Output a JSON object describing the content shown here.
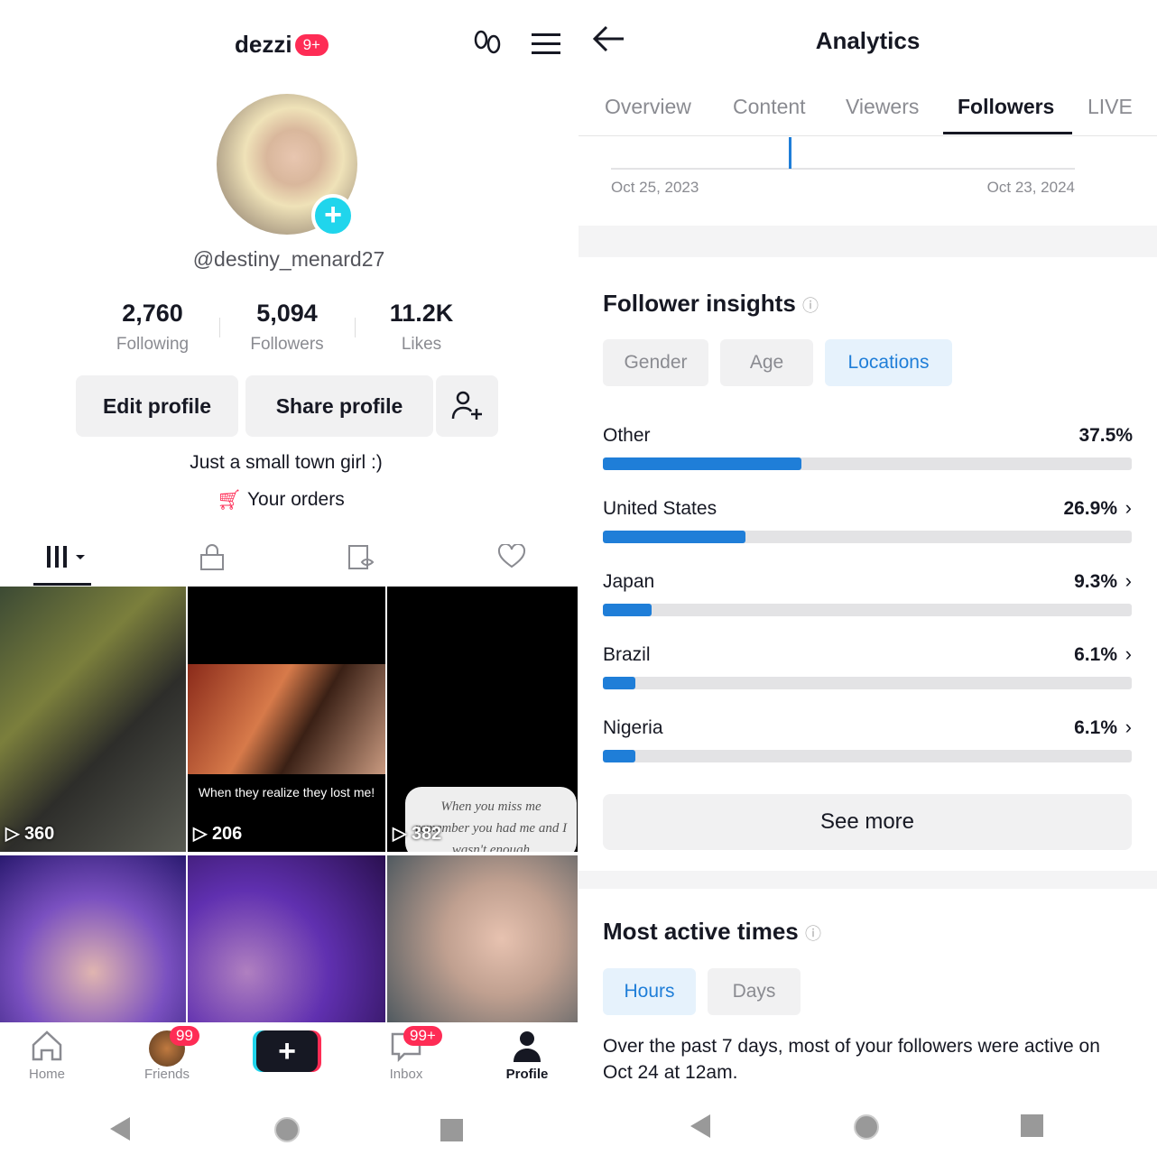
{
  "profile": {
    "display_name": "dezzi",
    "name_badge": "9+",
    "username": "@destiny_menard27",
    "stats": [
      {
        "value": "2,760",
        "label": "Following"
      },
      {
        "value": "5,094",
        "label": "Followers"
      },
      {
        "value": "11.2K",
        "label": "Likes"
      }
    ],
    "edit_profile": "Edit profile",
    "share_profile": "Share profile",
    "bio": "Just a small town girl :)",
    "orders": "Your orders",
    "videos": [
      {
        "views": "360",
        "caption": ""
      },
      {
        "views": "206",
        "caption": "When they realize they lost me!"
      },
      {
        "views": "382",
        "caption": "When you miss me remember you had me and I wasn't enough"
      },
      {
        "views": "",
        "caption": ""
      },
      {
        "views": "",
        "caption": ""
      },
      {
        "views": "",
        "caption": ""
      }
    ]
  },
  "bottom_nav": {
    "home": "Home",
    "friends": "Friends",
    "friends_badge": "99",
    "inbox": "Inbox",
    "inbox_badge": "99+",
    "profile": "Profile"
  },
  "analytics": {
    "title": "Analytics",
    "tabs": [
      "Overview",
      "Content",
      "Viewers",
      "Followers",
      "LIVE"
    ],
    "active_tab": "Followers",
    "chart_start": "Oct 25, 2023",
    "chart_end": "Oct 23, 2024",
    "insights_title": "Follower insights",
    "insight_chips": [
      "Gender",
      "Age",
      "Locations"
    ],
    "active_chip": "Locations",
    "locations": [
      {
        "name": "Other",
        "percent_label": "37.5%",
        "percent": 37.5,
        "chevron": false
      },
      {
        "name": "United States",
        "percent_label": "26.9%",
        "percent": 26.9,
        "chevron": true
      },
      {
        "name": "Japan",
        "percent_label": "9.3%",
        "percent": 9.3,
        "chevron": true
      },
      {
        "name": "Brazil",
        "percent_label": "6.1%",
        "percent": 6.1,
        "chevron": true
      },
      {
        "name": "Nigeria",
        "percent_label": "6.1%",
        "percent": 6.1,
        "chevron": true
      }
    ],
    "see_more": "See more",
    "active_title": "Most active times",
    "time_chips": [
      "Hours",
      "Days"
    ],
    "active_time_chip": "Hours",
    "active_text": "Over the past 7 days, most of your followers were active on Oct 24 at 12am."
  },
  "colors": {
    "accent": "#fe2c55",
    "blue": "#1f7ed8",
    "teal": "#20d5ec"
  }
}
